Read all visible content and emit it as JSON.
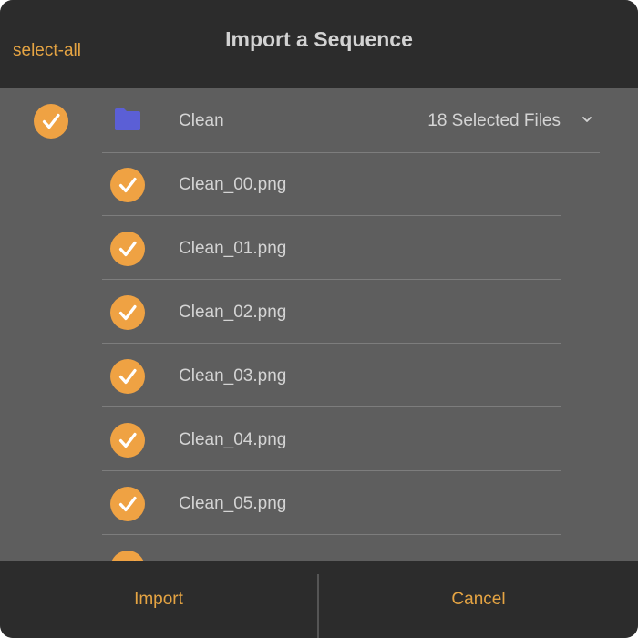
{
  "header": {
    "title": "Import a Sequence",
    "select_all_label": "select-all"
  },
  "folder": {
    "name": "Clean",
    "selected_count_label": "18 Selected Files",
    "checked": true
  },
  "files": [
    {
      "name": "Clean_00.png",
      "checked": true
    },
    {
      "name": "Clean_01.png",
      "checked": true
    },
    {
      "name": "Clean_02.png",
      "checked": true
    },
    {
      "name": "Clean_03.png",
      "checked": true
    },
    {
      "name": "Clean_04.png",
      "checked": true
    },
    {
      "name": "Clean_05.png",
      "checked": true
    },
    {
      "name": "",
      "checked": true
    }
  ],
  "footer": {
    "import_label": "Import",
    "cancel_label": "Cancel"
  },
  "colors": {
    "accent": "#e5a443",
    "check_fill": "#efa243",
    "folder_icon": "#5b5fd6",
    "bar_background": "#2c2c2c",
    "list_background": "#5e5e5e"
  },
  "icons": {
    "check": "checkmark-circle-icon",
    "folder": "folder-icon",
    "expand": "chevron-down-icon"
  }
}
